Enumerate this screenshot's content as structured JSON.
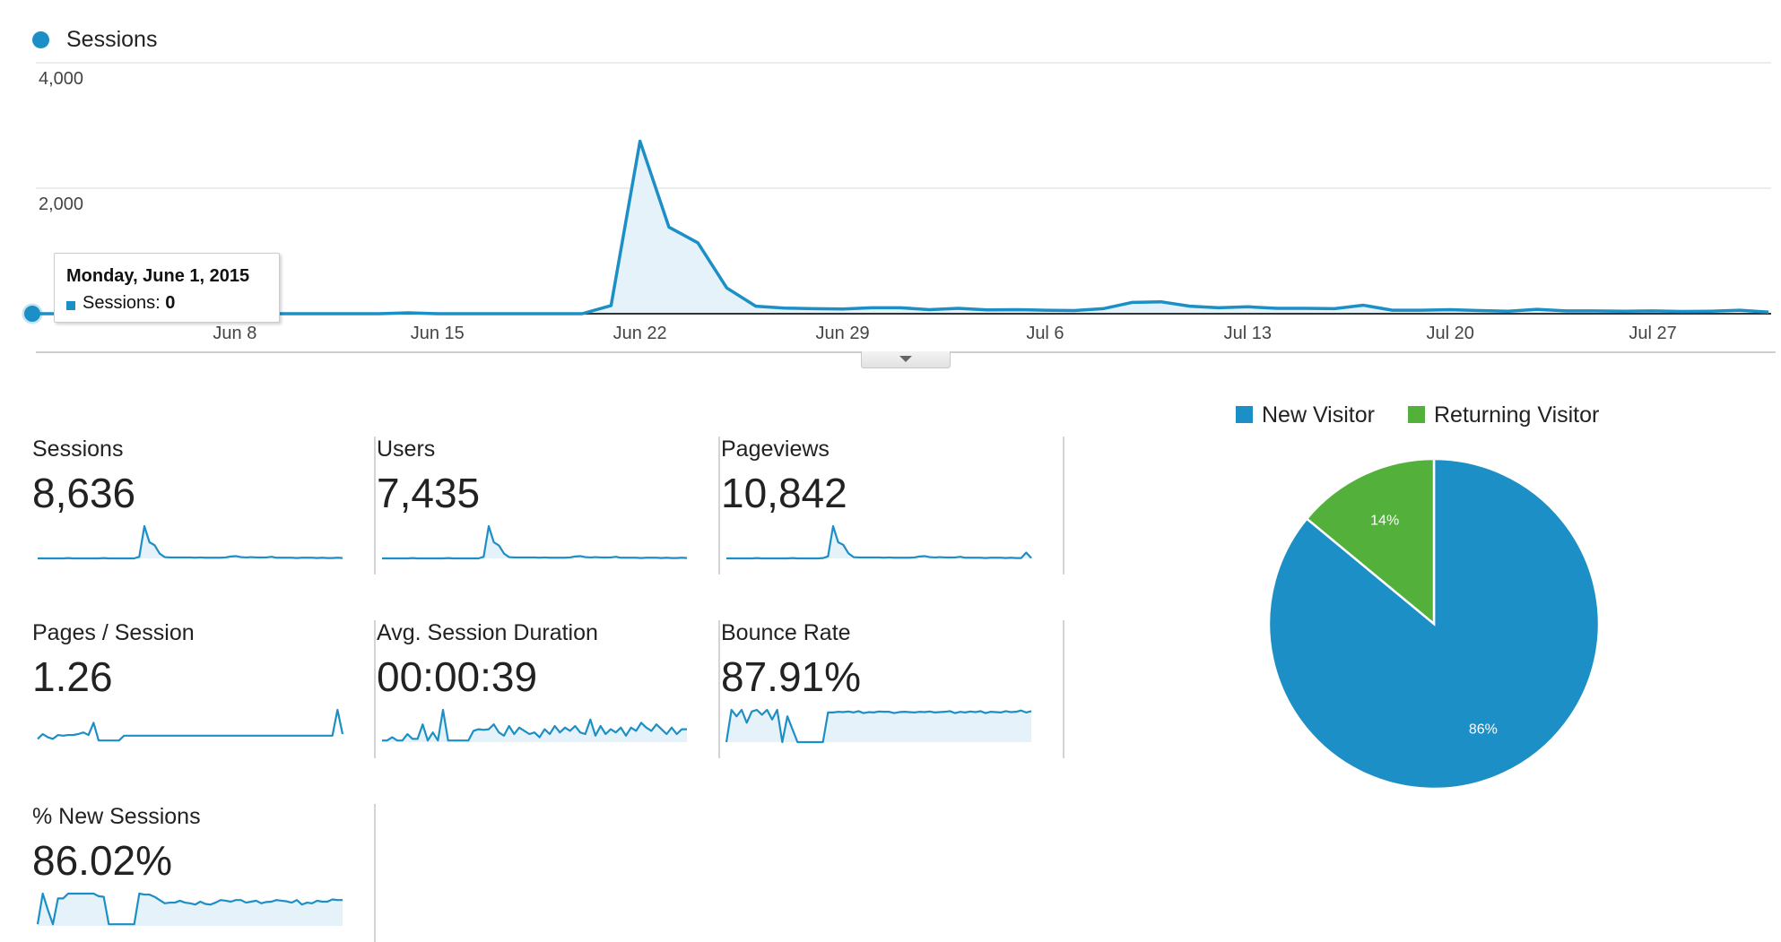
{
  "colors": {
    "primary": "#1b8fc6",
    "fill": "#e6f2fa",
    "secondary": "#53b13b",
    "grid": "#ececec",
    "axis": "#333333"
  },
  "main_chart": {
    "legend_label": "Sessions",
    "tooltip": {
      "date": "Monday, June 1, 2015",
      "series_label": "Sessions:",
      "value": "0"
    },
    "collapse_icon": "caret-down-icon"
  },
  "chart_data": [
    {
      "type": "area",
      "title": "",
      "series": [
        {
          "name": "Sessions",
          "values": [
            0,
            0,
            0,
            0,
            0,
            0,
            10,
            0,
            0,
            0,
            0,
            0,
            0,
            15,
            0,
            0,
            0,
            0,
            0,
            0,
            130,
            2750,
            1380,
            1130,
            410,
            120,
            90,
            80,
            75,
            95,
            95,
            65,
            85,
            60,
            65,
            55,
            50,
            80,
            180,
            190,
            120,
            95,
            110,
            85,
            85,
            80,
            135,
            55,
            55,
            65,
            50,
            40,
            70,
            45,
            45,
            40,
            45,
            35,
            40,
            55,
            25
          ]
        }
      ],
      "x": "daily, June 1 2015 – July 31 2015",
      "x_tick_labels": [
        "Jun 8",
        "Jun 15",
        "Jun 22",
        "Jun 29",
        "Jul 6",
        "Jul 13",
        "Jul 20",
        "Jul 27"
      ],
      "x_tick_day_index": [
        7,
        14,
        21,
        28,
        35,
        42,
        49,
        56
      ],
      "y_tick_labels": [
        "4,000",
        "2,000"
      ],
      "ylim": [
        0,
        4000
      ],
      "xlabel": "",
      "ylabel": "",
      "grid": true,
      "legend": "top-left"
    },
    {
      "type": "pie",
      "title": "",
      "categories": [
        "New Visitor",
        "Returning Visitor"
      ],
      "values": [
        86,
        14
      ],
      "labels": [
        "86%",
        "14%"
      ],
      "legend": "top"
    }
  ],
  "scorecards": [
    {
      "label": "Sessions",
      "value": "8,636",
      "spark": [
        0,
        0,
        0,
        0,
        0,
        0,
        1,
        0,
        0,
        0,
        0,
        0,
        0,
        1,
        0,
        0,
        0,
        0,
        0,
        0,
        5,
        100,
        50,
        41,
        15,
        4,
        3,
        3,
        3,
        3,
        3,
        2,
        3,
        2,
        2,
        2,
        2,
        3,
        6,
        7,
        4,
        3,
        4,
        3,
        3,
        3,
        5,
        2,
        2,
        2,
        2,
        1,
        2,
        2,
        2,
        1,
        2,
        1,
        1,
        2,
        1
      ],
      "spark_fill": true
    },
    {
      "label": "Users",
      "value": "7,435",
      "spark": [
        0,
        0,
        0,
        0,
        0,
        0,
        1,
        0,
        0,
        0,
        0,
        0,
        0,
        1,
        0,
        0,
        0,
        0,
        0,
        0,
        5,
        100,
        50,
        40,
        15,
        4,
        3,
        3,
        3,
        3,
        3,
        2,
        3,
        2,
        2,
        2,
        2,
        3,
        6,
        7,
        4,
        3,
        4,
        3,
        3,
        3,
        5,
        2,
        2,
        2,
        2,
        1,
        2,
        2,
        2,
        1,
        2,
        1,
        1,
        2,
        1
      ],
      "spark_fill": true
    },
    {
      "label": "Pageviews",
      "value": "10,842",
      "spark": [
        0,
        0,
        0,
        0,
        0,
        0,
        1,
        0,
        0,
        0,
        0,
        0,
        0,
        1,
        0,
        0,
        0,
        0,
        0,
        1,
        6,
        100,
        50,
        42,
        16,
        4,
        3,
        3,
        3,
        3,
        3,
        2,
        3,
        2,
        2,
        2,
        2,
        3,
        6,
        7,
        4,
        3,
        4,
        3,
        3,
        3,
        5,
        2,
        2,
        2,
        2,
        1,
        2,
        2,
        2,
        1,
        2,
        1,
        1,
        18,
        1
      ],
      "spark_fill": true
    },
    {
      "label": "Pages / Session",
      "value": "1.26",
      "spark": [
        10,
        25,
        15,
        10,
        22,
        20,
        22,
        22,
        25,
        30,
        22,
        60,
        5,
        5,
        5,
        5,
        5,
        20,
        20,
        20,
        20,
        20,
        20,
        20,
        20,
        20,
        20,
        20,
        20,
        20,
        20,
        20,
        20,
        20,
        20,
        20,
        20,
        20,
        20,
        20,
        20,
        20,
        20,
        20,
        20,
        20,
        20,
        20,
        20,
        20,
        20,
        20,
        20,
        20,
        20,
        20,
        20,
        20,
        20,
        100,
        25
      ],
      "spark_fill": false
    },
    {
      "label": "Avg. Session Duration",
      "value": "00:00:39",
      "spark": [
        5,
        5,
        15,
        5,
        5,
        25,
        10,
        10,
        55,
        5,
        30,
        5,
        100,
        5,
        5,
        5,
        5,
        5,
        35,
        40,
        38,
        40,
        55,
        30,
        20,
        50,
        25,
        45,
        35,
        25,
        30,
        15,
        40,
        25,
        50,
        30,
        45,
        35,
        50,
        30,
        25,
        70,
        20,
        50,
        25,
        40,
        30,
        45,
        20,
        45,
        35,
        60,
        45,
        35,
        55,
        40,
        25,
        45,
        25,
        40,
        40
      ],
      "spark_fill": true
    },
    {
      "label": "Bounce Rate",
      "value": "87.91%",
      "spark": [
        0,
        100,
        80,
        100,
        60,
        95,
        100,
        85,
        100,
        70,
        100,
        0,
        80,
        40,
        0,
        0,
        0,
        0,
        0,
        0,
        92,
        92,
        94,
        93,
        95,
        92,
        96,
        90,
        93,
        92,
        95,
        94,
        94,
        90,
        93,
        94,
        93,
        92,
        94,
        93,
        95,
        92,
        93,
        94,
        96,
        90,
        94,
        92,
        95,
        93,
        96,
        90,
        94,
        93,
        92,
        96,
        93,
        94,
        98,
        92,
        96
      ],
      "spark_fill": true
    },
    {
      "label": "% New Sessions",
      "value": "86.02%",
      "spark": [
        5,
        100,
        50,
        5,
        85,
        85,
        100,
        100,
        100,
        100,
        100,
        100,
        92,
        90,
        5,
        5,
        5,
        5,
        5,
        5,
        100,
        97,
        97,
        90,
        80,
        70,
        72,
        72,
        78,
        72,
        70,
        66,
        75,
        68,
        66,
        72,
        80,
        78,
        75,
        80,
        80,
        72,
        75,
        78,
        70,
        74,
        75,
        80,
        78,
        76,
        72,
        80,
        66,
        72,
        70,
        78,
        75,
        75,
        82,
        80,
        80
      ],
      "spark_fill": true
    }
  ],
  "pie_legend": [
    {
      "label": "New Visitor",
      "color": "#1b8fc6"
    },
    {
      "label": "Returning Visitor",
      "color": "#53b13b"
    }
  ]
}
